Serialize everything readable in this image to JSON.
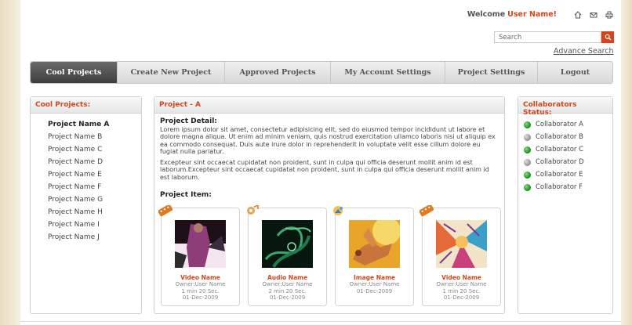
{
  "header": {
    "welcome": "Welcome",
    "user": "User Name!"
  },
  "search": {
    "placeholder": "Search",
    "advanced": "Advance Search"
  },
  "nav": [
    "Cool Projects",
    "Create New Project",
    "Approved Projects",
    "My Account Settings",
    "Project Settings",
    "Logout"
  ],
  "left": {
    "title": "Cool Projects:",
    "items": [
      "Project Name A",
      "Project Name B",
      "Project Name C",
      "Project Name D",
      "Project Name E",
      "Project Name F",
      "Project Name G",
      "Project Name H",
      "Project Name I",
      "Project Name J"
    ]
  },
  "main": {
    "title": "Project - A",
    "detail_label": "Project Detail:",
    "para1": "Lorem ipsum dolor sit amet, consectetur adipisicing elit, sed do eiusmod tempor incididunt ut labore et dolore magna aliqua. Ut enim ad minim veniam, quis nostrud exercitation ullamco laboris nisi ut aliquip ex ea commodo consequat. Duis aute irure dolor in reprehenderit in voluptate velit esse cillum dolore eu fugiat nulla pariatur.",
    "para2": "Excepteur sint occaecat cupidatat non proident, sunt in culpa qui officia deserunt mollit anim id est laborum.Excepteur sint occaecat cupidatat non proident, sunt in culpa qui officia deserunt mollit anim id est laborum.",
    "item_label": "Project Item:",
    "items": [
      {
        "name": "Video Name",
        "owner": "Owner:User Name",
        "duration": "1 min 20 Sec.",
        "date": "01-Dec-2009"
      },
      {
        "name": "Audio Name",
        "owner": "Owner:User Name",
        "duration": "2 min 20 Sec.",
        "date": "01-Dec-2009"
      },
      {
        "name": "Image Name",
        "owner": "Owner:User Name",
        "date": "01-Dec-2009"
      },
      {
        "name": "Video Name",
        "owner": "Owner:User Name",
        "duration": "1 min 20 Sec.",
        "date": "01-Dec-2009"
      }
    ]
  },
  "collab": {
    "title": "Collaborators Status:",
    "items": [
      {
        "name": "Collaborator  A",
        "status": "online"
      },
      {
        "name": "Collaborator  B",
        "status": "offline"
      },
      {
        "name": "Collaborator  C",
        "status": "online"
      },
      {
        "name": "Collaborator  D",
        "status": "offline"
      },
      {
        "name": "Collaborator  E",
        "status": "online"
      },
      {
        "name": "Collaborator  F",
        "status": "online"
      }
    ]
  },
  "colors": {
    "accent": "#d2461b",
    "online": "#0f8a12",
    "offline": "#8c8c8c"
  }
}
